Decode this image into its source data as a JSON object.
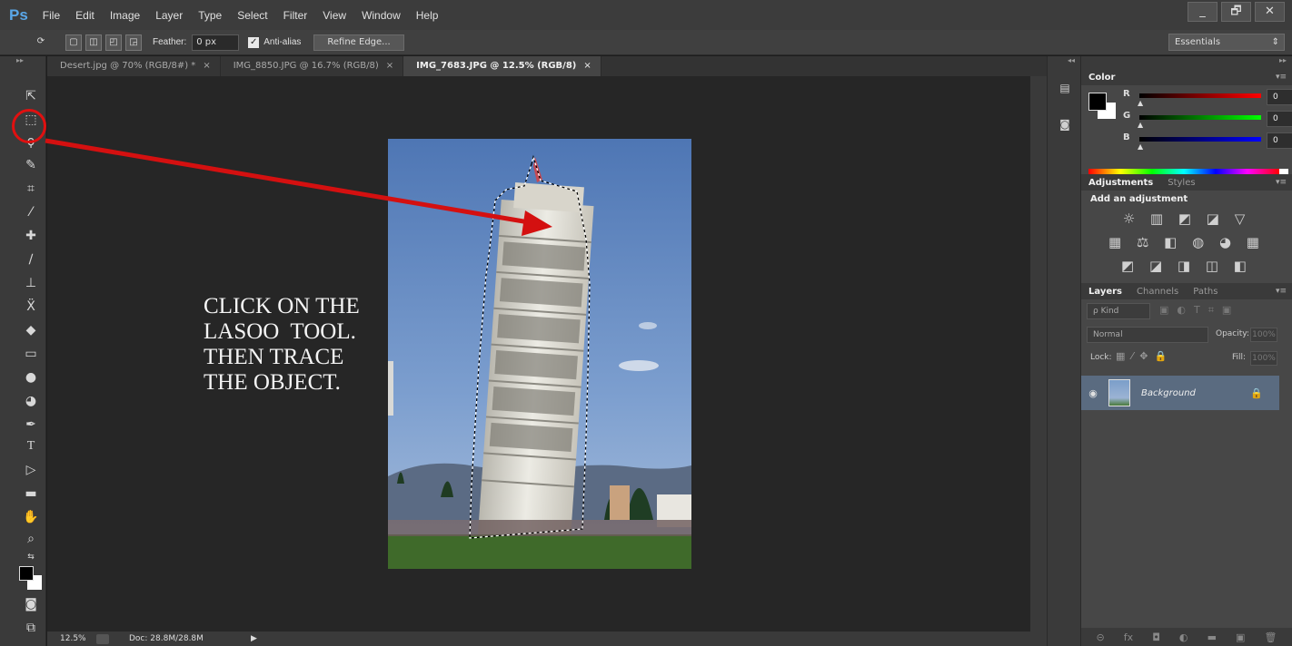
{
  "app": {
    "logo": "Ps",
    "menu": [
      "File",
      "Edit",
      "Image",
      "Layer",
      "Type",
      "Select",
      "Filter",
      "View",
      "Window",
      "Help"
    ],
    "window_controls": [
      "_",
      "🗗",
      "✕"
    ]
  },
  "options_bar": {
    "feather_label": "Feather:",
    "feather_value": "0 px",
    "antialias_label": "Anti-alias",
    "antialias_checked": true,
    "refine_edge_label": "Refine Edge...",
    "workspace_value": "Essentials"
  },
  "tools": {
    "icons": [
      "move-tool-icon",
      "marquee-tool-icon",
      "lasso-tool-icon",
      "quick-selection-tool-icon",
      "crop-tool-icon",
      "eyedropper-tool-icon",
      "healing-brush-tool-icon",
      "brush-tool-icon",
      "clone-stamp-tool-icon",
      "history-brush-tool-icon",
      "eraser-tool-icon",
      "gradient-tool-icon",
      "blur-tool-icon",
      "dodge-tool-icon",
      "pen-tool-icon",
      "type-tool-icon",
      "path-selection-tool-icon",
      "rectangle-tool-icon",
      "hand-tool-icon",
      "zoom-tool-icon"
    ],
    "highlighted": "lasso-tool-icon"
  },
  "document_tabs": [
    {
      "label": "Desert.jpg @ 70% (RGB/8#) *",
      "active": false
    },
    {
      "label": "IMG_8850.JPG @ 16.7% (RGB/8)",
      "active": false
    },
    {
      "label": "IMG_7683.JPG @ 12.5% (RGB/8)",
      "active": true
    }
  ],
  "annotation": {
    "lines": [
      "CLICK ON THE",
      "LASOO  TOOL.",
      "THEN TRACE",
      "THE OBJECT."
    ],
    "arrow_color": "#d41010"
  },
  "status": {
    "zoom": "12.5%",
    "doc": "Doc: 28.8M/28.8M"
  },
  "color_panel": {
    "tabs": [
      "Color"
    ],
    "r_label": "R",
    "r_value": "0",
    "g_label": "G",
    "g_value": "0",
    "b_label": "B",
    "b_value": "0"
  },
  "adjustments_panel": {
    "tabs": [
      "Adjustments",
      "Styles"
    ],
    "title": "Add an adjustment",
    "row1": "☼ ▥ ◩ ◪ ▽",
    "row2": "▦ ⚖ ◧ ◍ ◕ ▦",
    "row3": "◩ ◪ ◨ ◫ ◧"
  },
  "layers_panel": {
    "tabs": [
      "Layers",
      "Channels",
      "Paths"
    ],
    "kind": "ρ Kind",
    "blend_mode": "Normal",
    "opacity_label": "Opacity:",
    "opacity_value": "100%",
    "lock_label": "Lock:",
    "fill_label": "Fill:",
    "fill_value": "100%",
    "layers": [
      {
        "name": "Background",
        "locked": true,
        "visible": true
      }
    ]
  }
}
